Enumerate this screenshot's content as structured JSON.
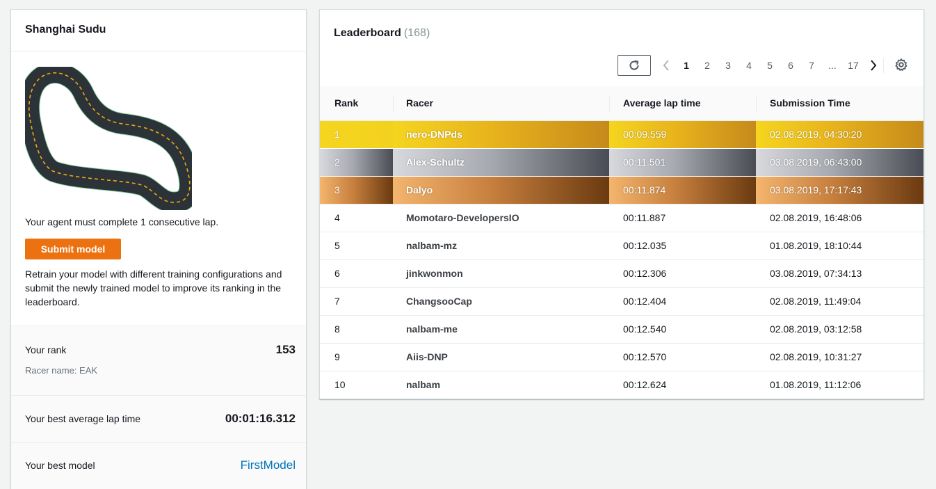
{
  "track_panel": {
    "title": "Shanghai Sudu",
    "requirement": "Your agent must complete 1 consecutive lap.",
    "submit_label": "Submit model",
    "retrain_text": "Retrain your model with different training configurations and submit the newly trained model to improve its ranking in the leaderboard.",
    "rank_label": "Your rank",
    "rank_value": "153",
    "racer_name": "Racer name: EAK",
    "best_lap_label": "Your best average lap time",
    "best_lap_value": "00:01:16.312",
    "best_model_label": "Your best model",
    "best_model_value": "FirstModel"
  },
  "leaderboard": {
    "title": "Leaderboard",
    "count": "(168)",
    "pages": [
      "1",
      "2",
      "3",
      "4",
      "5",
      "6",
      "7",
      "...",
      "17"
    ],
    "active_page": "1",
    "columns": [
      "Rank",
      "Racer",
      "Average lap time",
      "Submission Time"
    ],
    "rows": [
      {
        "rank": "1",
        "racer": "nero-DNPds",
        "lap": "00:09.559",
        "time": "02.08.2019, 04:30:20",
        "medal": "gold"
      },
      {
        "rank": "2",
        "racer": "Alex-Schultz",
        "lap": "00:11.501",
        "time": "03.08.2019, 06:43:00",
        "medal": "silver"
      },
      {
        "rank": "3",
        "racer": "Dalyo",
        "lap": "00:11.874",
        "time": "03.08.2019, 17:17:43",
        "medal": "bronze"
      },
      {
        "rank": "4",
        "racer": "Momotaro-DevelopersIO",
        "lap": "00:11.887",
        "time": "02.08.2019, 16:48:06",
        "medal": ""
      },
      {
        "rank": "5",
        "racer": "nalbam-mz",
        "lap": "00:12.035",
        "time": "01.08.2019, 18:10:44",
        "medal": ""
      },
      {
        "rank": "6",
        "racer": "jinkwonmon",
        "lap": "00:12.306",
        "time": "03.08.2019, 07:34:13",
        "medal": ""
      },
      {
        "rank": "7",
        "racer": "ChangsooCap",
        "lap": "00:12.404",
        "time": "02.08.2019, 11:49:04",
        "medal": ""
      },
      {
        "rank": "8",
        "racer": "nalbam-me",
        "lap": "00:12.540",
        "time": "02.08.2019, 03:12:58",
        "medal": ""
      },
      {
        "rank": "9",
        "racer": "Aiis-DNP",
        "lap": "00:12.570",
        "time": "02.08.2019, 10:31:27",
        "medal": ""
      },
      {
        "rank": "10",
        "racer": "nalbam",
        "lap": "00:12.624",
        "time": "01.08.2019, 11:12:06",
        "medal": ""
      }
    ]
  },
  "colors": {
    "accent": "#ec7211",
    "link": "#0073bb",
    "gold": "#e8b41c",
    "silver": "#a7a9b0",
    "bronze": "#c7803e"
  },
  "icons": {
    "refresh": "refresh-icon",
    "prev": "chevron-left-icon",
    "next": "chevron-right-icon",
    "settings": "gear-icon"
  }
}
